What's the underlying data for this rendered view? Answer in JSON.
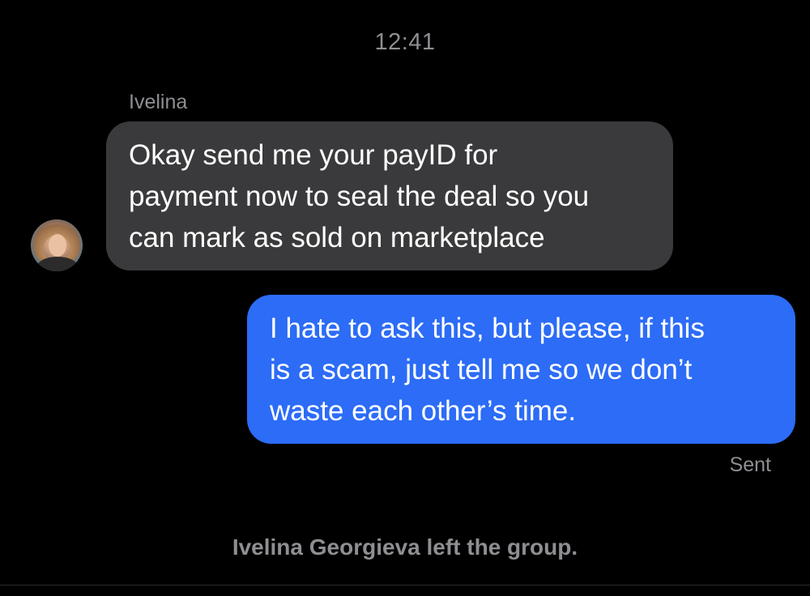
{
  "conversation": {
    "timestamp": "12:41",
    "incoming": {
      "sender_name": "Ivelina",
      "avatar_icon": "profile-photo",
      "lines": [
        "Okay send me your payID for",
        "payment now to seal the deal so you",
        "can mark as sold on marketplace"
      ]
    },
    "outgoing": {
      "lines": [
        "I hate to ask this, but please, if this",
        "is a scam, just tell me so we don’t",
        "waste each other’s time."
      ],
      "status": "Sent"
    },
    "system_message": "Ivelina Georgieva left the group."
  },
  "colors": {
    "background": "#000000",
    "incoming_bubble": "#3a3a3c",
    "outgoing_bubble": "#2c6cf6",
    "secondary_text": "#8e8e93"
  }
}
